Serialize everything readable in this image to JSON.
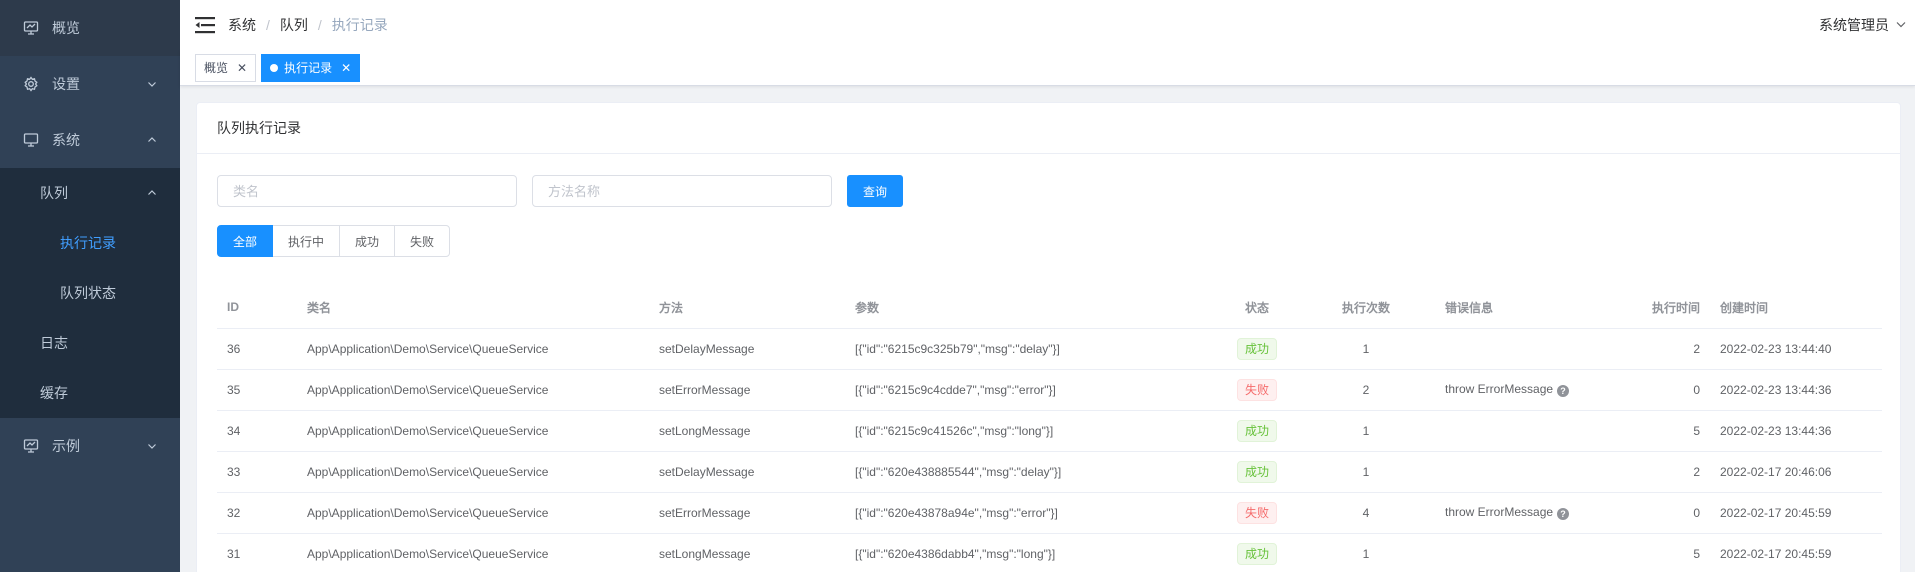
{
  "sidebar": {
    "items": [
      {
        "label": "概览",
        "icon": "screen-icon"
      },
      {
        "label": "设置",
        "icon": "gear-icon"
      },
      {
        "label": "系统",
        "icon": "monitor-icon"
      },
      {
        "label": "队列"
      },
      {
        "label": "执行记录"
      },
      {
        "label": "队列状态"
      },
      {
        "label": "日志"
      },
      {
        "label": "缓存"
      },
      {
        "label": "示例",
        "icon": "screen-icon"
      }
    ]
  },
  "navbar": {
    "breadcrumb": [
      "系统",
      "队列",
      "执行记录"
    ],
    "separator": "/",
    "user": "系统管理员"
  },
  "tags": [
    {
      "label": "概览",
      "close": "✕"
    },
    {
      "label": "执行记录",
      "close": "✕"
    }
  ],
  "card": {
    "title": "队列执行记录",
    "class_placeholder": "类名",
    "method_placeholder": "方法名称",
    "search_button": "查询",
    "status_filters": [
      "全部",
      "执行中",
      "成功",
      "失败"
    ]
  },
  "table": {
    "headers": [
      "ID",
      "类名",
      "方法",
      "参数",
      "状态",
      "执行次数",
      "错误信息",
      "执行时间",
      "创建时间"
    ],
    "rows": [
      {
        "id": "36",
        "class": "App\\Application\\Demo\\Service\\QueueService",
        "method": "setDelayMessage",
        "params": "[{\"id\":\"6215c9c325b79\",\"msg\":\"delay\"}]",
        "status": "成功",
        "count": "1",
        "error": "",
        "exec_time": "2",
        "created": "2022-02-23 13:44:40"
      },
      {
        "id": "35",
        "class": "App\\Application\\Demo\\Service\\QueueService",
        "method": "setErrorMessage",
        "params": "[{\"id\":\"6215c9c4cdde7\",\"msg\":\"error\"}]",
        "status": "失败",
        "count": "2",
        "error": "throw ErrorMessage",
        "exec_time": "0",
        "created": "2022-02-23 13:44:36"
      },
      {
        "id": "34",
        "class": "App\\Application\\Demo\\Service\\QueueService",
        "method": "setLongMessage",
        "params": "[{\"id\":\"6215c9c41526c\",\"msg\":\"long\"}]",
        "status": "成功",
        "count": "1",
        "error": "",
        "exec_time": "5",
        "created": "2022-02-23 13:44:36"
      },
      {
        "id": "33",
        "class": "App\\Application\\Demo\\Service\\QueueService",
        "method": "setDelayMessage",
        "params": "[{\"id\":\"620e438885544\",\"msg\":\"delay\"}]",
        "status": "成功",
        "count": "1",
        "error": "",
        "exec_time": "2",
        "created": "2022-02-17 20:46:06"
      },
      {
        "id": "32",
        "class": "App\\Application\\Demo\\Service\\QueueService",
        "method": "setErrorMessage",
        "params": "[{\"id\":\"620e43878a94e\",\"msg\":\"error\"}]",
        "status": "失败",
        "count": "4",
        "error": "throw ErrorMessage",
        "exec_time": "0",
        "created": "2022-02-17 20:45:59"
      },
      {
        "id": "31",
        "class": "App\\Application\\Demo\\Service\\QueueService",
        "method": "setLongMessage",
        "params": "[{\"id\":\"620e4386dabb4\",\"msg\":\"long\"}]",
        "status": "成功",
        "count": "1",
        "error": "",
        "exec_time": "5",
        "created": "2022-02-17 20:45:59"
      }
    ]
  },
  "colors": {
    "sidebar_bg": "#304156",
    "sidebar_active": "#409eff",
    "primary": "#1890ff",
    "success": "#67c23a",
    "danger": "#f56c6c"
  }
}
